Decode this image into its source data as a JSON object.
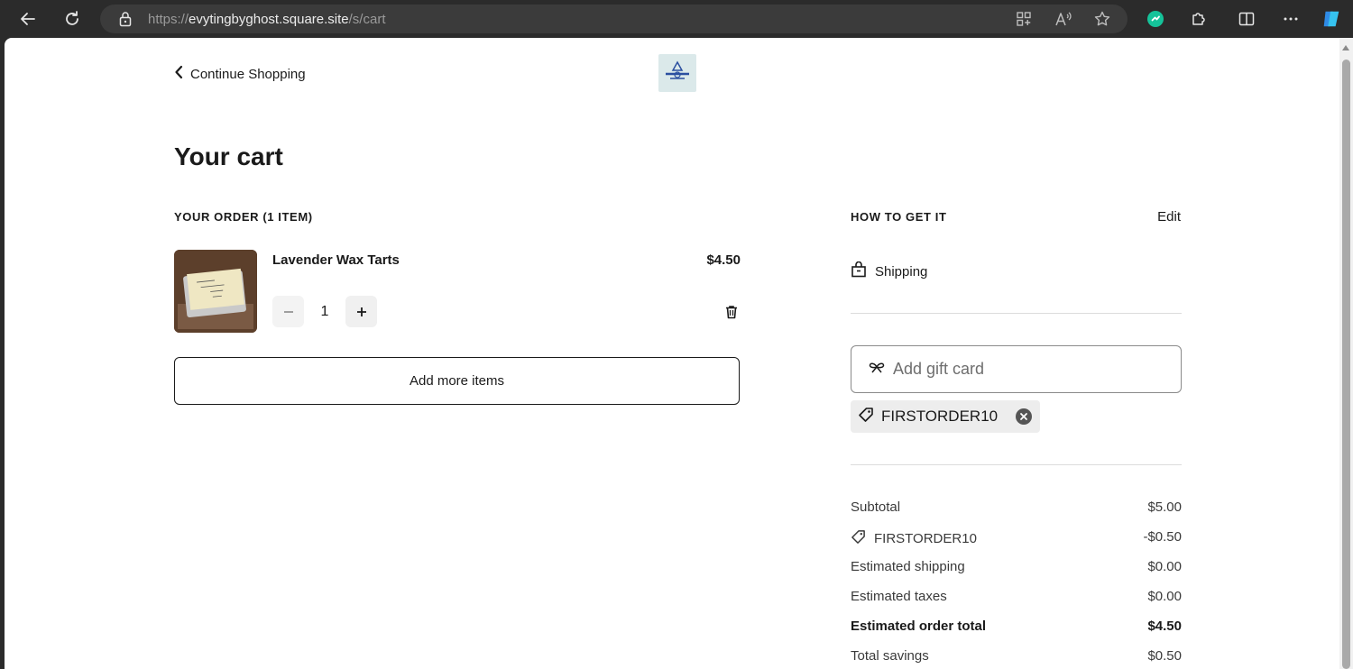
{
  "browser": {
    "url_scheme": "https://",
    "url_host": "evytingbyghost.square.site",
    "url_path": "/s/cart"
  },
  "header": {
    "continue_label": "Continue Shopping"
  },
  "page": {
    "title": "Your cart"
  },
  "order": {
    "heading": "YOUR ORDER (1 ITEM)",
    "items": [
      {
        "name": "Lavender Wax Tarts",
        "price": "$4.50",
        "quantity": "1"
      }
    ],
    "add_more_label": "Add more items"
  },
  "fulfillment": {
    "heading": "HOW TO GET IT",
    "edit_label": "Edit",
    "method": "Shipping"
  },
  "gift_card": {
    "placeholder": "Add gift card"
  },
  "coupon": {
    "code": "FIRSTORDER10"
  },
  "summary": {
    "rows": [
      {
        "label": "Subtotal",
        "value": "$5.00"
      },
      {
        "label": "FIRSTORDER10",
        "value": "-$0.50"
      },
      {
        "label": "Estimated shipping",
        "value": "$0.00"
      },
      {
        "label": "Estimated taxes",
        "value": "$0.00"
      },
      {
        "label": "Estimated order total",
        "value": "$4.50"
      },
      {
        "label": "Total savings",
        "value": "$0.50"
      }
    ]
  },
  "colors": {
    "accent_text": "#1a1a1a",
    "chrome_bg": "#2b2b2b",
    "grammarly_green": "#15c39a"
  }
}
